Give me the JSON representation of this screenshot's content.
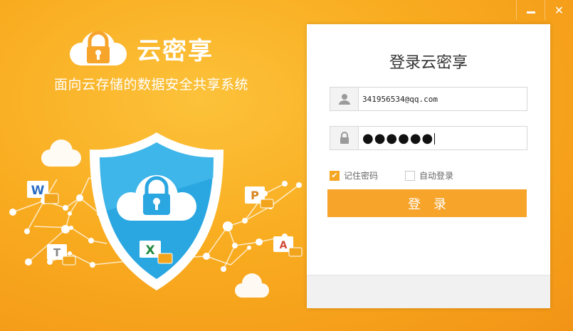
{
  "window": {
    "minimize_glyph": "—",
    "close_glyph": "✕"
  },
  "brand": {
    "name": "云密享",
    "slogan": "面向云存储的数据安全共享系统",
    "logo_icon": "cloud-lock-icon"
  },
  "illustration": {
    "shield_icon": "shield-cloud-lock-icon",
    "file_badges": [
      "W",
      "T",
      "X",
      "P",
      "A"
    ]
  },
  "login": {
    "title": "登录云密享",
    "username": {
      "icon": "user-icon",
      "value": "341956534@qq.com"
    },
    "password": {
      "icon": "lock-icon",
      "value": "●●●●●●"
    },
    "remember_password": {
      "label": "记住密码",
      "checked": true
    },
    "auto_login": {
      "label": "自动登录",
      "checked": false
    },
    "submit_label": "登录"
  },
  "colors": {
    "background": "#f9ac20",
    "accent": "#f7a42b",
    "shield_blue": "#2aa7e1"
  }
}
